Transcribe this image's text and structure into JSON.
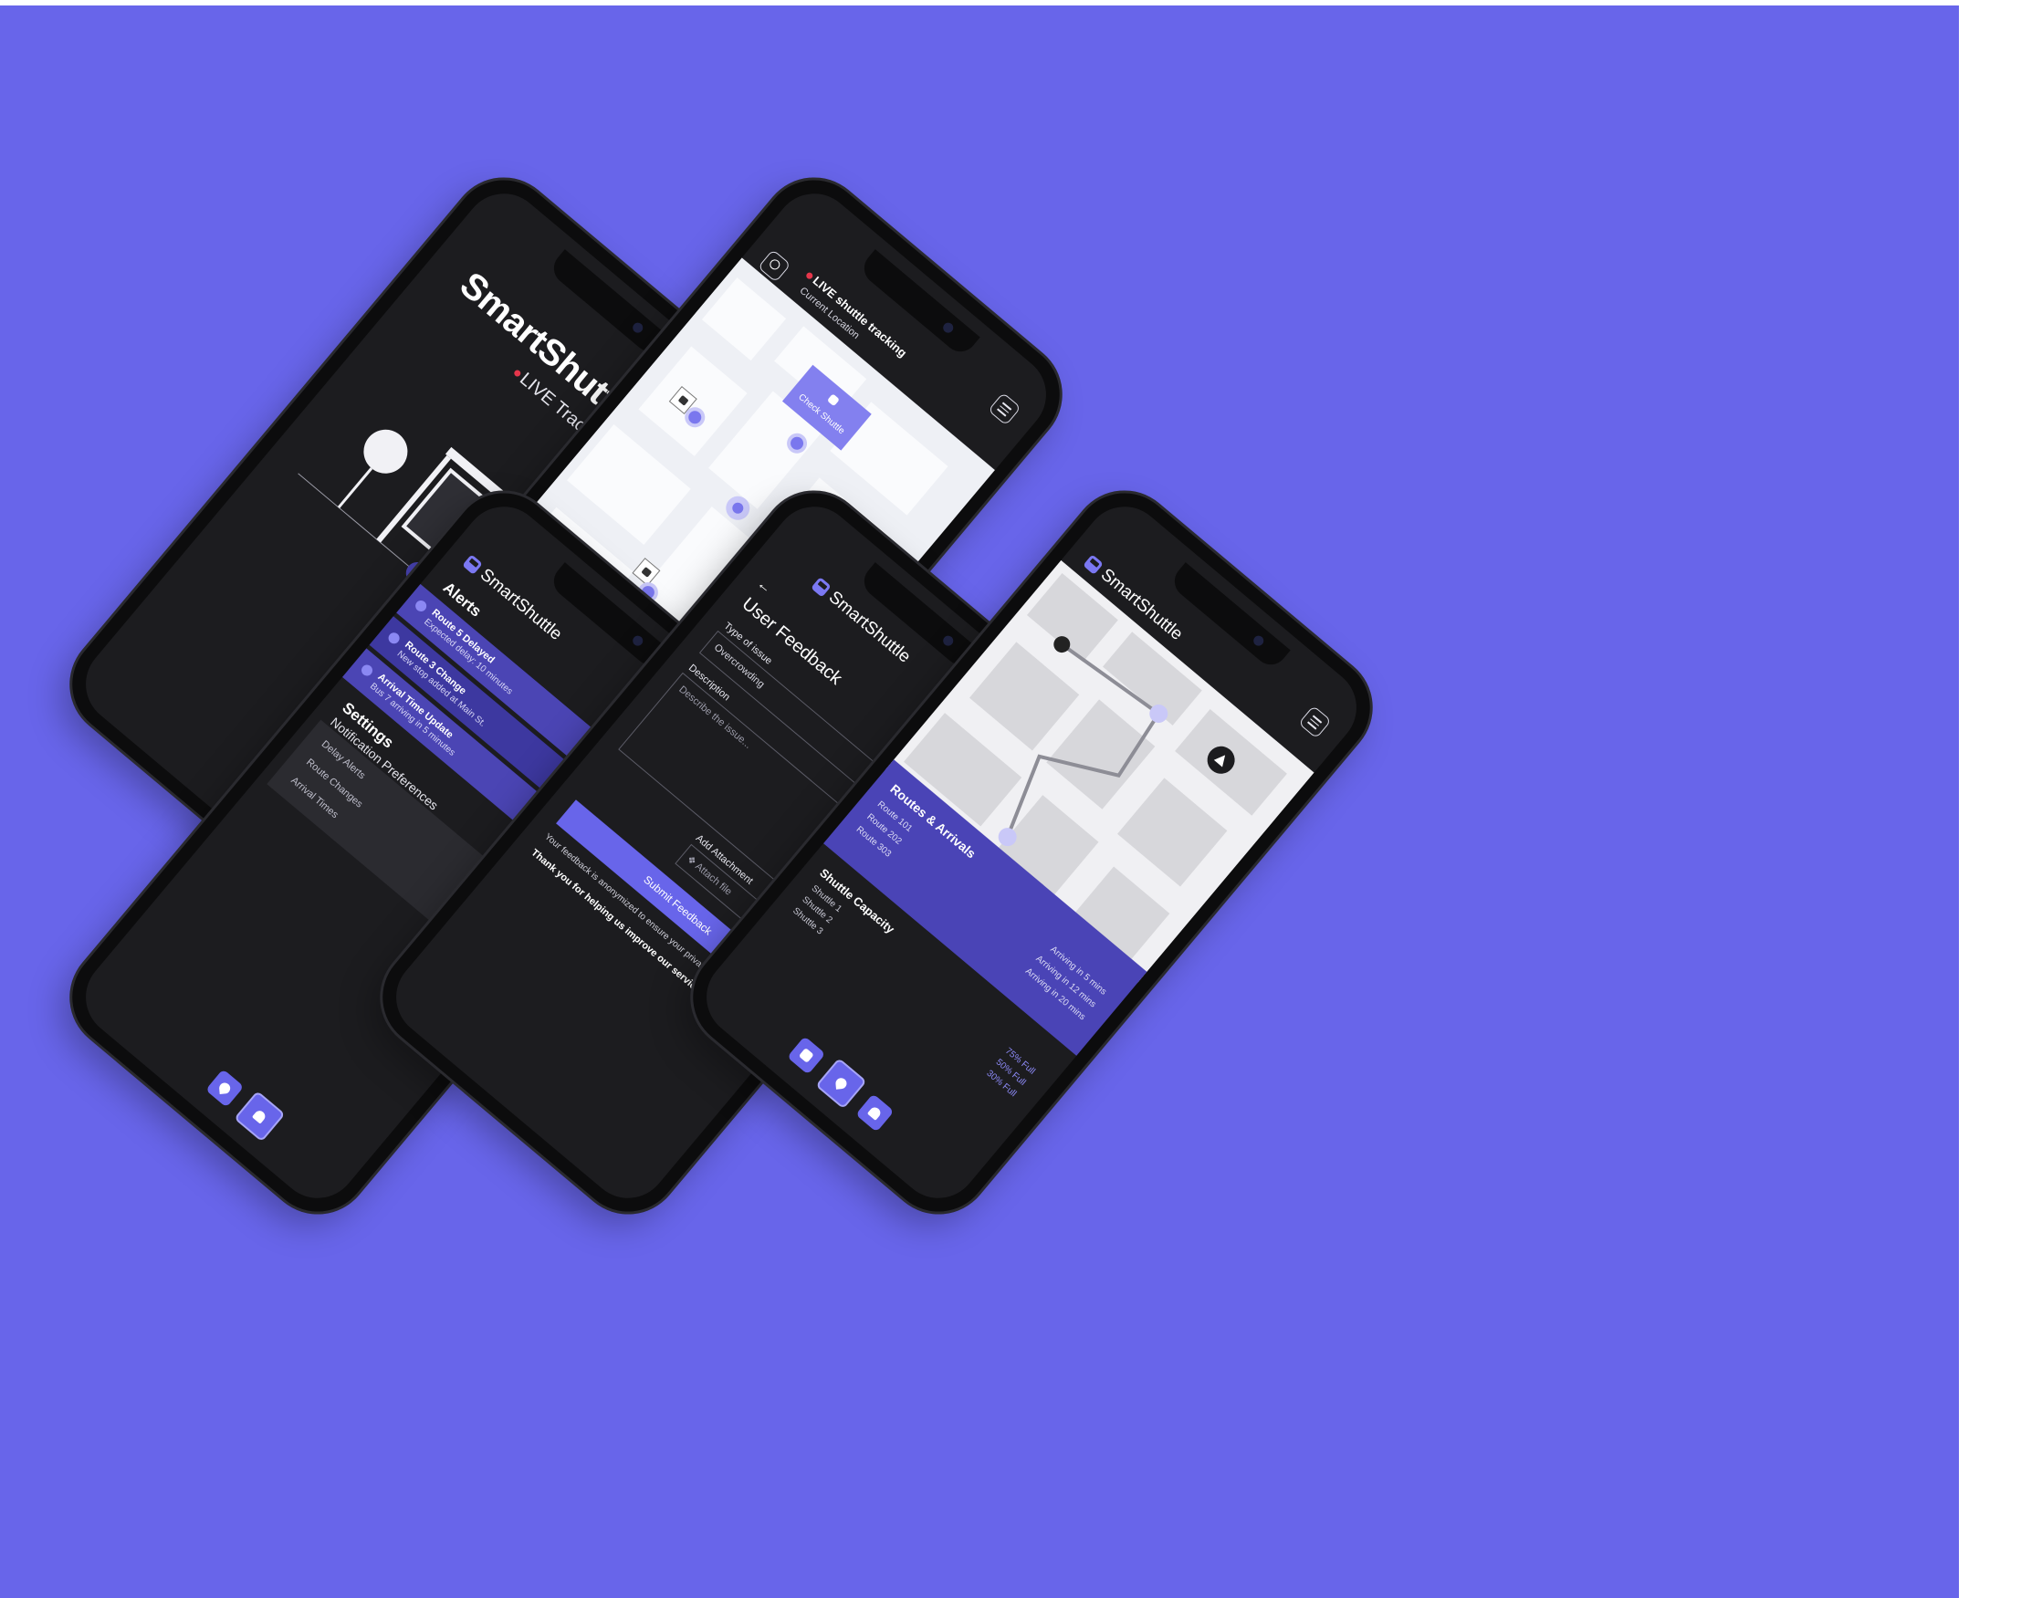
{
  "app": {
    "name": "SmartShuttle",
    "live_tag": "LIVE Tracker"
  },
  "colors": {
    "background": "#6865ea",
    "accent": "#6865ea",
    "surface": "#1c1c1f",
    "panel": "#4a44b6",
    "live": "#e5364b"
  },
  "tracking": {
    "title": "LIVE shuttle tracking",
    "subtitle": "Current Location",
    "check_card": "Check Shuttle"
  },
  "alerts": {
    "heading": "Alerts",
    "items": [
      {
        "title": "Route 5 Delayed",
        "detail": "Expected delay: 10 minutes"
      },
      {
        "title": "Route 3 Change",
        "detail": "New stop added at Main St."
      },
      {
        "title": "Arrival Time Update",
        "detail": "Bus 7 arriving in 5 minutes"
      }
    ]
  },
  "settings": {
    "heading": "Settings",
    "subheading": "Notification Preferences",
    "prefs": [
      "Delay Alerts",
      "Route Changes",
      "Arrival Times"
    ]
  },
  "feedback": {
    "title": "User Feedback",
    "type_label": "Type of issue",
    "type_value": "Overcrowding",
    "desc_label": "Description",
    "desc_placeholder": "Describe the issue...",
    "attach_label": "Add Attachment",
    "attach_button": "Attach file",
    "submit": "Submit Feedback",
    "privacy_note": "Your feedback is anonymized to ensure your privacy.",
    "thanks": "Thank you for helping us improve our service."
  },
  "routes": {
    "heading": "Routes & Arrivals",
    "items": [
      {
        "route": "Route 101",
        "eta": "Arriving in 5 mins"
      },
      {
        "route": "Route 202",
        "eta": "Arriving in 12 mins"
      },
      {
        "route": "Route 303",
        "eta": "Arriving in 20 mins"
      }
    ]
  },
  "capacity": {
    "heading": "Shuttle Capacity",
    "items": [
      {
        "name": "Shuttle 1",
        "value": "75% Full"
      },
      {
        "name": "Shuttle 2",
        "value": "50% Full"
      },
      {
        "name": "Shuttle 3",
        "value": "30% Full"
      }
    ]
  }
}
